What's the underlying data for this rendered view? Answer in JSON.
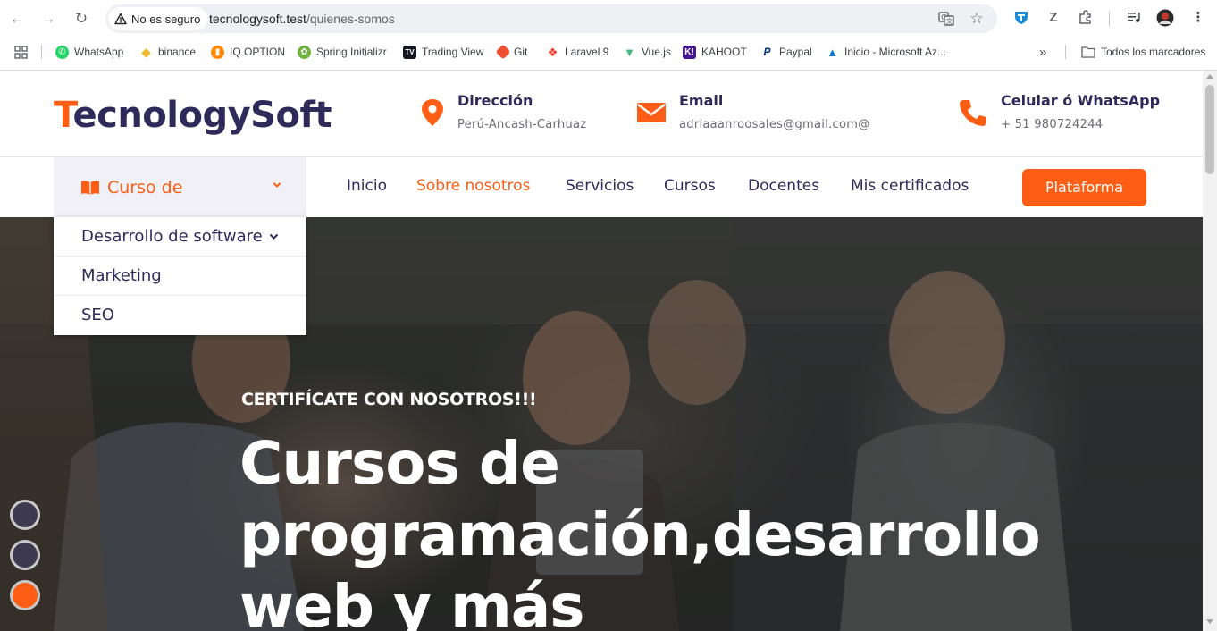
{
  "browser": {
    "security_label": "No es seguro",
    "url_host": "tecnologysoft.test",
    "url_path": "/quienes-somos",
    "bookmarks": [
      {
        "label": "WhatsApp",
        "icon": "whatsapp-icon",
        "color": "#25d366"
      },
      {
        "label": "binance",
        "icon": "binance-icon",
        "color": "#f3ba2f"
      },
      {
        "label": "IQ OPTION",
        "icon": "iqoption-icon",
        "color": "#ff8a00"
      },
      {
        "label": "Spring Initializr",
        "icon": "spring-icon",
        "color": "#6db33f"
      },
      {
        "label": "Trading View",
        "icon": "tradingview-icon",
        "color": "#131722"
      },
      {
        "label": "Git",
        "icon": "git-icon",
        "color": "#f05032"
      },
      {
        "label": "Laravel 9",
        "icon": "laravel-icon",
        "color": "#ff2d20"
      },
      {
        "label": "Vue.js",
        "icon": "vue-icon",
        "color": "#42b883"
      },
      {
        "label": "KAHOOT",
        "icon": "kahoot-icon",
        "color": "#46178f"
      },
      {
        "label": "Paypal",
        "icon": "paypal-icon",
        "color": "#003087"
      },
      {
        "label": "Inicio - Microsoft Az...",
        "icon": "azure-icon",
        "color": "#0078d4"
      }
    ],
    "more_bookmarks": "»",
    "all_bookmarks_label": "Todos los marcadores"
  },
  "header": {
    "logo_first": "T",
    "logo_rest": "ecnologySoft",
    "address": {
      "title": "Dirección",
      "text": "Perú-Ancash-Carhuaz"
    },
    "email": {
      "title": "Email",
      "text": "adriaaanroosales@gmail.com@"
    },
    "phone": {
      "title": "Celular ó WhatsApp",
      "text": "+ 51 980724244"
    }
  },
  "nav": {
    "category_label": "Curso de",
    "links": [
      "Inicio",
      "Sobre nosotros",
      "Servicios",
      "Cursos",
      "Docentes",
      "Mis certificados"
    ],
    "active": "Sobre nosotros",
    "platform_button": "Plataforma"
  },
  "dropdown": {
    "items": [
      "Desarrollo de software",
      "Marketing",
      "SEO"
    ]
  },
  "hero": {
    "subtitle": "CERTIFÍCATE CON NOSOTROS!!!",
    "title_line1": "Cursos de",
    "title_line2": "programación,desarrollo",
    "title_line3": "web y más"
  },
  "colors": {
    "accent": "#fd5d14",
    "brand_dark": "#2f2a5a"
  }
}
